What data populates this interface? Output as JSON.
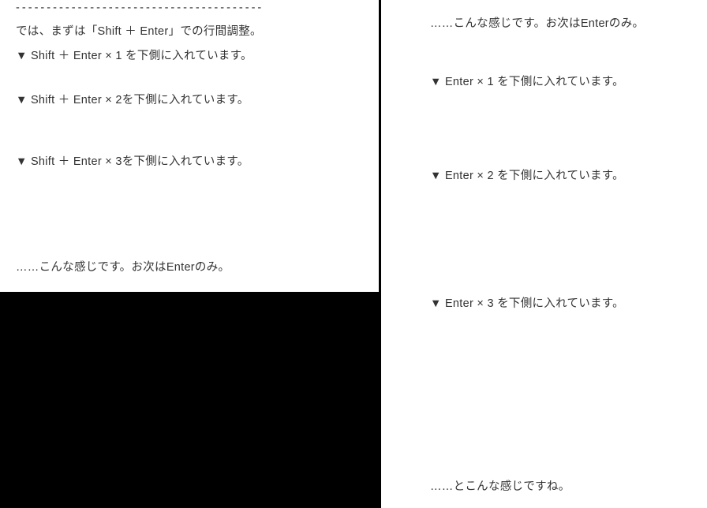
{
  "left": {
    "dashes": "- - - - - - - - - - - - - - - - - - - - - - - - - - - - - - - - - - - - - - - -",
    "intro": "では、まずは「Shift ＋ Enter」での行間調整。",
    "l1": "▼ Shift ＋ Enter × 1 を下側に入れています。",
    "l2": "▼ Shift ＋ Enter × 2を下側に入れています。",
    "l3": "▼ Shift ＋ Enter × 3を下側に入れています。",
    "outro": "……こんな感じです。お次はEnterのみ。"
  },
  "right": {
    "top": "……こんな感じです。お次はEnterのみ。",
    "r1": "▼ Enter × 1 を下側に入れています。",
    "r2": "▼ Enter × 2 を下側に入れています。",
    "r3": "▼ Enter × 3 を下側に入れています。",
    "outro": "……とこんな感じですね。"
  }
}
